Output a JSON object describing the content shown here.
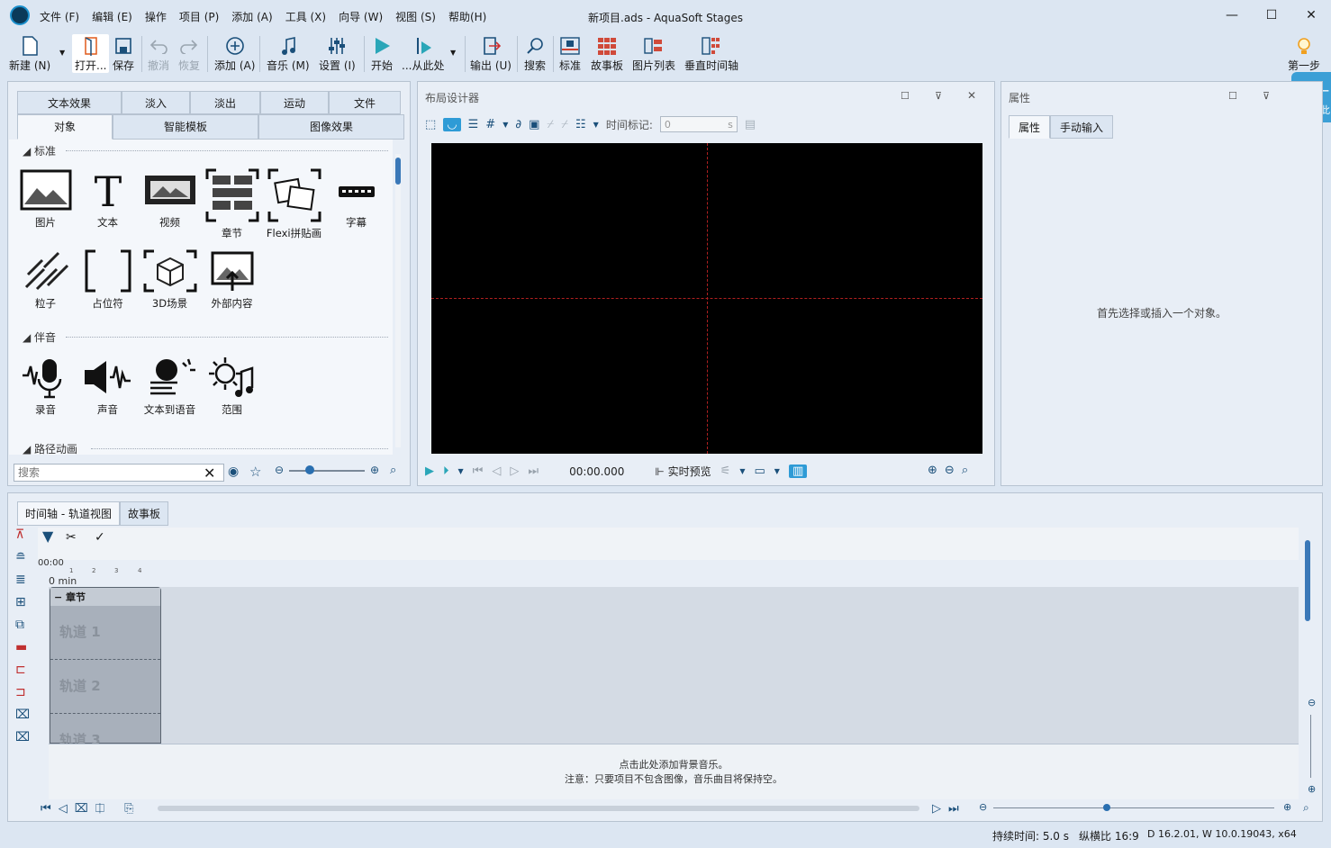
{
  "window": {
    "title": "新项目.ads - AquaSoft Stages"
  },
  "menu": [
    "文件 (F)",
    "编辑 (E)",
    "操作",
    "项目 (P)",
    "添加 (A)",
    "工具 (X)",
    "向导 (W)",
    "视图 (S)",
    "帮助(H)"
  ],
  "toolbar": {
    "new": "新建 (N)",
    "open": "打开...",
    "save": "保存",
    "undo": "撤消",
    "redo": "恢复",
    "add": "添加 (A)",
    "music": "音乐 (M)",
    "settings": "设置 (I)",
    "start": "开始",
    "from_here": "...从此处",
    "output": "输出 (U)",
    "search": "搜索",
    "standard": "标准",
    "storyboard": "故事板",
    "piclist": "图片列表",
    "vtimeline": "垂直时间轴",
    "first": "第一步"
  },
  "tooltip": {
    "title": "第一",
    "sub": "点击此"
  },
  "left_panel": {
    "tabs_top": [
      "文本效果",
      "淡入",
      "淡出",
      "运动",
      "文件"
    ],
    "tabs_bottom": [
      "对象",
      "智能模板",
      "图像效果"
    ],
    "sections": {
      "standard": "标准",
      "audio": "伴音",
      "path": "路径动画"
    },
    "standard_items": [
      "图片",
      "文本",
      "视频",
      "章节",
      "Flexi拼贴画",
      "字幕",
      "粒子",
      "占位符",
      "3D场景",
      "外部内容"
    ],
    "audio_items": [
      "录音",
      "声音",
      "文本到语音",
      "范围"
    ],
    "search_placeholder": "搜索"
  },
  "layout_designer": {
    "title": "布局设计器",
    "time_mark_label": "时间标记:",
    "time_value": "0",
    "time_unit": "s",
    "time": "00:00.000",
    "realtime": "实时预览"
  },
  "properties": {
    "title": "属性",
    "tabs": [
      "属性",
      "手动输入"
    ],
    "empty": "首先选择或插入一个对象。"
  },
  "timeline": {
    "tabs": [
      "时间轴 - 轨道视图",
      "故事板"
    ],
    "time": "00:00",
    "min": "0 min",
    "ticks": [
      "1",
      "2",
      "3",
      "4"
    ],
    "chapter": "章节",
    "tracks": [
      "轨道 1",
      "轨道 2",
      "轨道 3"
    ],
    "music_hint": "点击此处添加背景音乐。",
    "music_note": "注意：只要项目不包含图像，音乐曲目将保持空。"
  },
  "status": {
    "duration": "持续时间: 5.0 s",
    "aspect": "纵横比 16:9",
    "version": "D 16.2.01, W 10.0.19043, x64"
  }
}
